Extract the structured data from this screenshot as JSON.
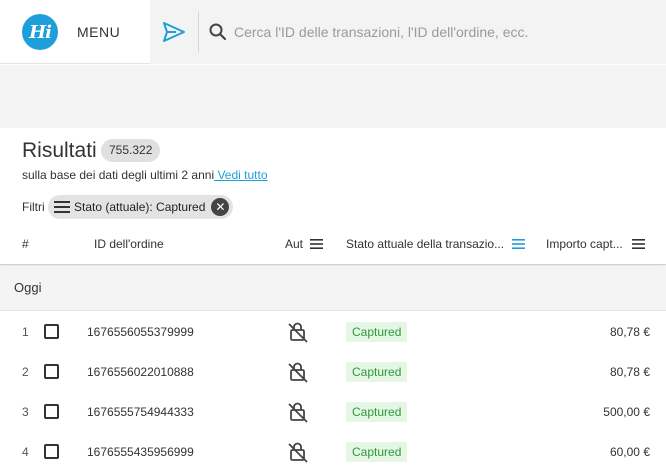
{
  "header": {
    "logo_text": "Hi",
    "menu_label": "MENU",
    "search_placeholder": "Cerca l'ID delle transazioni, l'ID dell'ordine, ecc.",
    "accent_color": "#1e9fd9"
  },
  "results": {
    "title": "Risultati",
    "count": "755.322",
    "subtitle": "sulla base dei dati degli ultimi 2 anni",
    "see_all": " Vedi tutto"
  },
  "filters": {
    "label": "Filtri",
    "chip_label": "Stato (attuale): Captured"
  },
  "table": {
    "columns": {
      "num": "#",
      "order_id": "ID dell'ordine",
      "auth": "Aut",
      "status": "Stato attuale della transazio...",
      "amount": "Importo capt..."
    },
    "group_label": "Oggi",
    "rows": [
      {
        "num": "1",
        "order_id": "1676556055379999",
        "status": "Captured",
        "amount": "80,78 €"
      },
      {
        "num": "2",
        "order_id": "1676556022010888",
        "status": "Captured",
        "amount": "80,78 €"
      },
      {
        "num": "3",
        "order_id": "1676555754944333",
        "status": "Captured",
        "amount": "500,00 €"
      },
      {
        "num": "4",
        "order_id": "1676555435956999",
        "status": "Captured",
        "amount": "60,00 €"
      }
    ]
  }
}
